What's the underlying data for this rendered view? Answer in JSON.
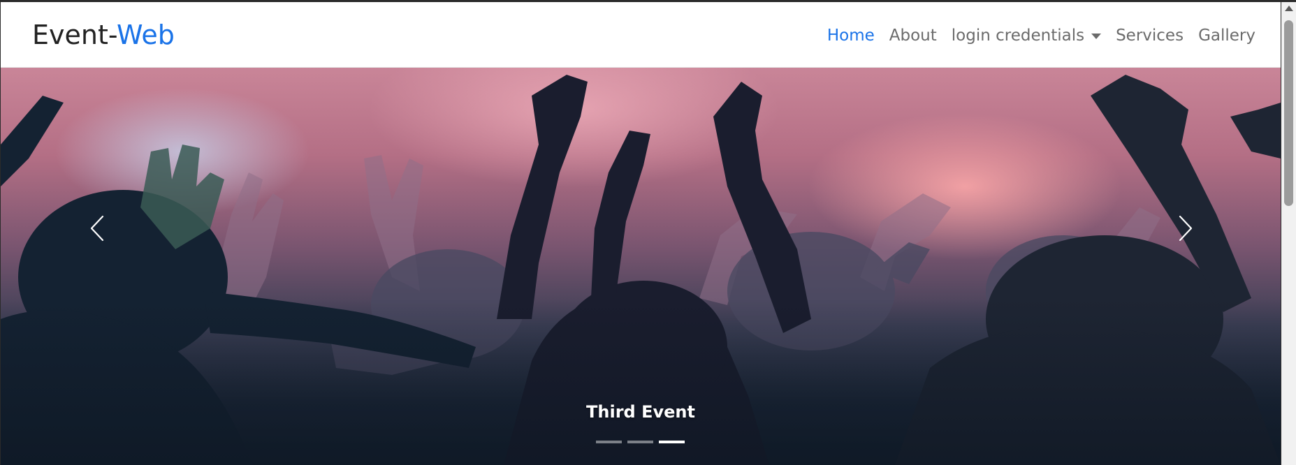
{
  "brand": {
    "part1": "Event-",
    "part2": "Web"
  },
  "nav": {
    "home": "Home",
    "about": "About",
    "login": "login credentials",
    "services": "Services",
    "gallery": "Gallery"
  },
  "carousel": {
    "caption": "Third Event",
    "slide_count": 3,
    "active_index": 3
  },
  "icons": {
    "prev": "chevron-left-icon",
    "next": "chevron-right-icon",
    "dropdown": "caret-down-icon"
  },
  "colors": {
    "accent": "#1a73e8",
    "nav_text": "#6b6b6b",
    "brand_text": "#222222"
  }
}
